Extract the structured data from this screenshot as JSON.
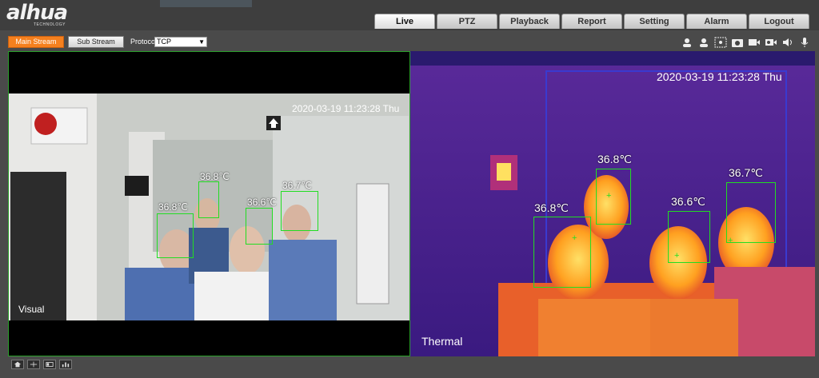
{
  "header": {
    "logo_text": "alhua",
    "logo_sub": "TECHNOLOGY",
    "nav_tabs": [
      {
        "label": "Live",
        "active": true
      },
      {
        "label": "PTZ",
        "active": false
      },
      {
        "label": "Playback",
        "active": false
      },
      {
        "label": "Report",
        "active": false
      },
      {
        "label": "Setting",
        "active": false
      },
      {
        "label": "Alarm",
        "active": false
      },
      {
        "label": "Logout",
        "active": false
      }
    ]
  },
  "toolbar": {
    "main_stream_label": "Main Stream",
    "sub_stream_label": "Sub Stream",
    "protocol_label": "Protocol",
    "protocol_value": "TCP",
    "icons": [
      "stream-person-icon",
      "stream-person-2-icon",
      "area-select-icon",
      "snapshot-icon",
      "record-icon",
      "zoom-record-icon",
      "volume-icon",
      "microphone-icon"
    ]
  },
  "visual_pane": {
    "label": "Visual",
    "timestamp": "2020-03-19 11:23:28 Thu",
    "readings": [
      "36.8℃",
      "36.8℃",
      "36.6℃",
      "36.7℃"
    ]
  },
  "thermal_pane": {
    "label": "Thermal",
    "timestamp": "2020-03-19 11:23:28 Thu",
    "readings": [
      "36.8℃",
      "36.8℃",
      "36.6℃",
      "36.7℃"
    ]
  },
  "bottombar": {
    "icons": [
      "screen-home-icon",
      "screen-split-icon",
      "window-layout-icon",
      "stats-icon"
    ]
  },
  "colors": {
    "accent": "#f5801e",
    "detect_box": "#22dd22",
    "pane_border": "#2aa02a"
  }
}
